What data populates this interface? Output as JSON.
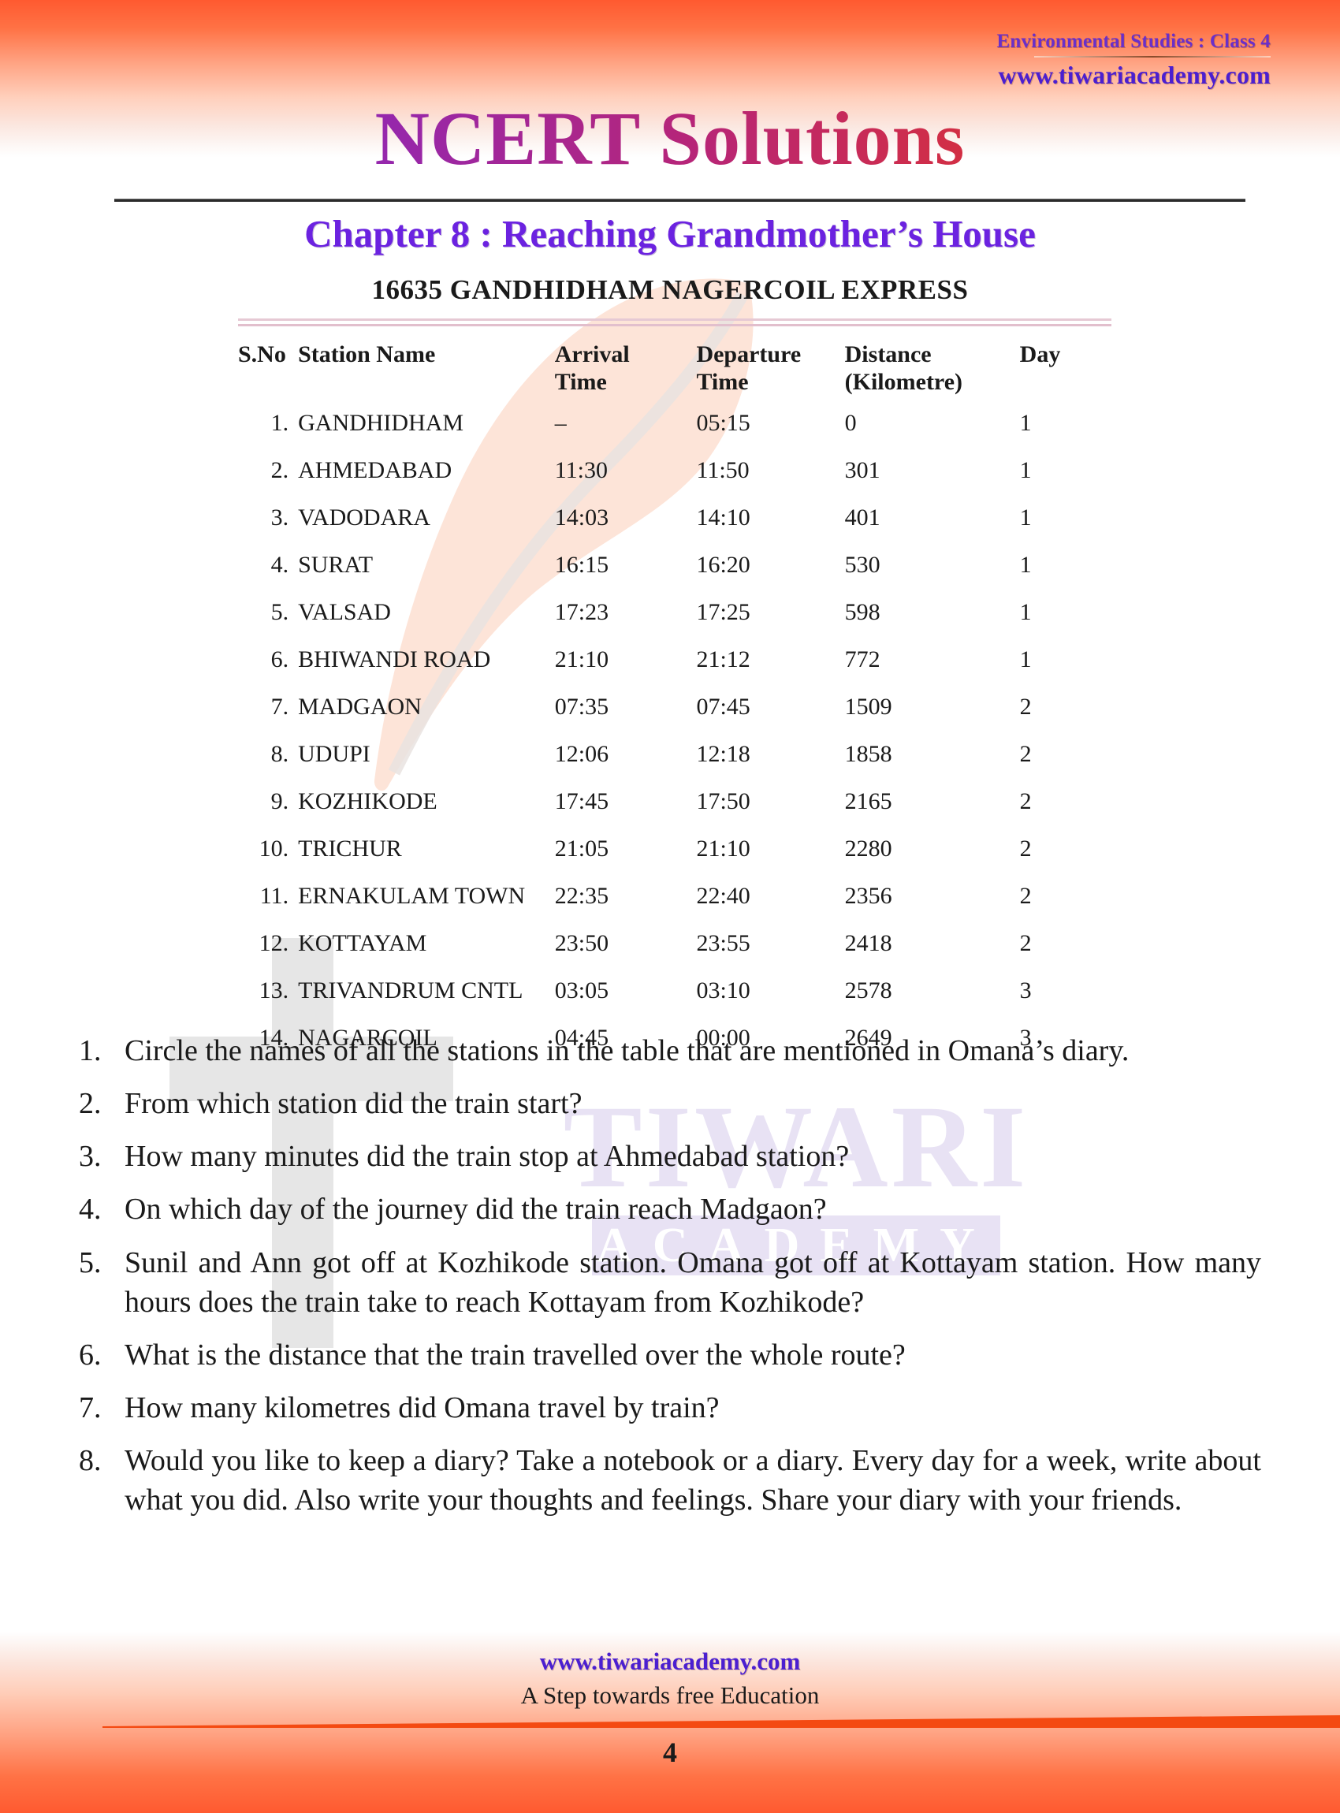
{
  "header": {
    "course": "Environmental Studies : Class 4",
    "website": "www.tiwariacademy.com",
    "main_title": "NCERT Solutions",
    "chapter_title": "Chapter 8 : Reaching Grandmother’s House"
  },
  "train": {
    "title": "16635  GANDHIDHAM  NAGERCOIL  EXPRESS",
    "columns": {
      "sno": "S.No",
      "station": "Station  Name",
      "arrival_l1": "Arrival",
      "arrival_l2": "Time",
      "departure_l1": "Departure",
      "departure_l2": "Time",
      "distance_l1": "Distance",
      "distance_l2": "(Kilometre)",
      "day": "Day"
    },
    "rows": [
      {
        "sno": "1.",
        "station": "GANDHIDHAM",
        "arrival": "–",
        "departure": "05:15",
        "distance": "0",
        "day": "1"
      },
      {
        "sno": "2.",
        "station": "AHMEDABAD",
        "arrival": "11:30",
        "departure": "11:50",
        "distance": "301",
        "day": "1"
      },
      {
        "sno": "3.",
        "station": "VADODARA",
        "arrival": "14:03",
        "departure": "14:10",
        "distance": "401",
        "day": "1"
      },
      {
        "sno": "4.",
        "station": "SURAT",
        "arrival": "16:15",
        "departure": "16:20",
        "distance": "530",
        "day": "1"
      },
      {
        "sno": "5.",
        "station": "VALSAD",
        "arrival": "17:23",
        "departure": "17:25",
        "distance": "598",
        "day": "1"
      },
      {
        "sno": "6.",
        "station": "BHIWANDI ROAD",
        "arrival": "21:10",
        "departure": "21:12",
        "distance": "772",
        "day": "1"
      },
      {
        "sno": "7.",
        "station": "MADGAON",
        "arrival": "07:35",
        "departure": "07:45",
        "distance": "1509",
        "day": "2"
      },
      {
        "sno": "8.",
        "station": "UDUPI",
        "arrival": "12:06",
        "departure": "12:18",
        "distance": "1858",
        "day": "2"
      },
      {
        "sno": "9.",
        "station": "KOZHIKODE",
        "arrival": "17:45",
        "departure": "17:50",
        "distance": "2165",
        "day": "2"
      },
      {
        "sno": "10.",
        "station": "TRICHUR",
        "arrival": "21:05",
        "departure": "21:10",
        "distance": "2280",
        "day": "2"
      },
      {
        "sno": "11.",
        "station": "ERNAKULAM  TOWN",
        "arrival": "22:35",
        "departure": "22:40",
        "distance": "2356",
        "day": "2"
      },
      {
        "sno": "12.",
        "station": "KOTTAYAM",
        "arrival": "23:50",
        "departure": "23:55",
        "distance": "2418",
        "day": "2"
      },
      {
        "sno": "13.",
        "station": "TRIVANDRUM CNTL",
        "arrival": "03:05",
        "departure": "03:10",
        "distance": "2578",
        "day": "3"
      },
      {
        "sno": "14.",
        "station": "NAGARCOIL",
        "arrival": "04:45",
        "departure": "00:00",
        "distance": "2649",
        "day": "3"
      }
    ]
  },
  "questions": [
    {
      "num": "1.",
      "text": "Circle the names of all the stations in the table that are mentioned in Omana’s diary."
    },
    {
      "num": "2.",
      "text": "From which station did the train start?"
    },
    {
      "num": "3.",
      "text": "How many minutes did the train stop at Ahmedabad station?"
    },
    {
      "num": "4.",
      "text": "On which day of the journey did the train reach Madgaon?"
    },
    {
      "num": "5.",
      "text": "Sunil and Ann got off at Kozhikode station. Omana got off at Kottayam station. How many hours does the train take to reach Kottayam from Kozhikode?"
    },
    {
      "num": "6.",
      "text": "What is the distance that the train travelled over the whole route?"
    },
    {
      "num": "7.",
      "text": "How many kilometres did Omana travel by train?"
    },
    {
      "num": "8.",
      "text": "Would you like to keep a diary? Take a notebook or a diary. Every day for a week, write about what you did. Also write your thoughts and feelings. Share your diary with your friends."
    }
  ],
  "watermark": {
    "main": "TIWARI",
    "sub": "ACADEMY"
  },
  "footer": {
    "website": "www.tiwariacademy.com",
    "tagline": "A Step towards free Education",
    "page_number": "4"
  },
  "colors": {
    "page_border_orange": "#ff5a30",
    "title_gradient_start": "#7a29c9",
    "title_gradient_end": "#ef3b22",
    "chapter_purple": "#6b22e0",
    "link_purple": "#4b1fd0",
    "course_purple": "#6a2fc9",
    "table_rule_pink": "#e6c9d4",
    "watermark_lilac": "#e8e2f4",
    "watermark_grey": "#e6e6e6"
  }
}
